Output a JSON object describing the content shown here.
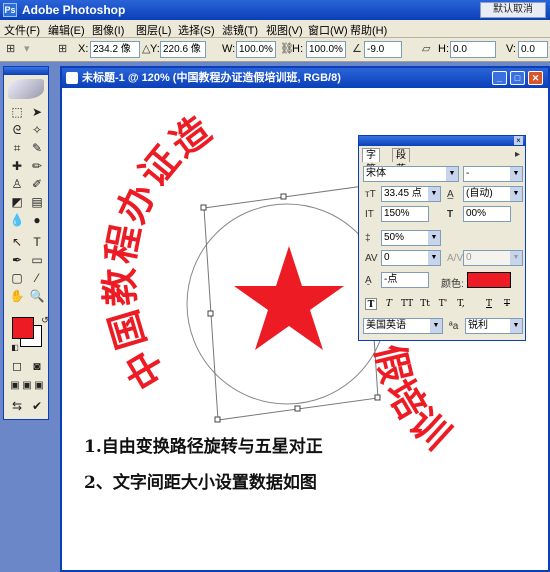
{
  "app": {
    "title": "Adobe Photoshop",
    "corner_button": "默认取消"
  },
  "menu": [
    "文件(F)",
    "编辑(E)",
    "图像(I)",
    "图层(L)",
    "选择(S)",
    "滤镜(T)",
    "视图(V)",
    "窗口(W)",
    "帮助(H)"
  ],
  "options": {
    "x_label": "X:",
    "x_value": "234.2 像",
    "y_label": "Y:",
    "y_value": "220.6 像",
    "w_label": "W:",
    "w_value": "100.0%",
    "h_label": "H:",
    "h_value": "100.0%",
    "angle_value": "-9.0",
    "h_skew_label": "H:",
    "h_skew_value": "0.0",
    "v_skew_label": "V:",
    "v_skew_value": "0.0"
  },
  "document": {
    "title": "未标题-1 @ 120% (中国教程办证造假培训班, RGB/8)"
  },
  "canvas": {
    "stamp_text_left": "中国教程办证造",
    "stamp_text_right": "假培训",
    "stamp_color": "#ed1c24",
    "caption_line1": "1.自由变换路径旋转与五星对正",
    "caption_line2": "2、文字间距大小设置数据如图"
  },
  "char_panel": {
    "tab_character": "字符",
    "tab_paragraph": "段落",
    "font_family": "宋体",
    "font_style": "-",
    "font_size": "33.45 点",
    "leading": "(自动)",
    "vertical_scale": "150%",
    "horizontal_scale": "00%",
    "kerning": "50%",
    "tracking": "0",
    "baseline_label": "0",
    "baseline_value": "-点",
    "color_label": "颜色:",
    "language": "美国英语",
    "antialias": "锐利",
    "style_buttons": [
      "T",
      "T",
      "TT",
      "Tt",
      "T'",
      "T,",
      "T",
      "T"
    ],
    "text_color": "#ed1c24"
  },
  "toolbox": {
    "foreground_color": "#ed1c24",
    "background_color": "#ffffff"
  }
}
